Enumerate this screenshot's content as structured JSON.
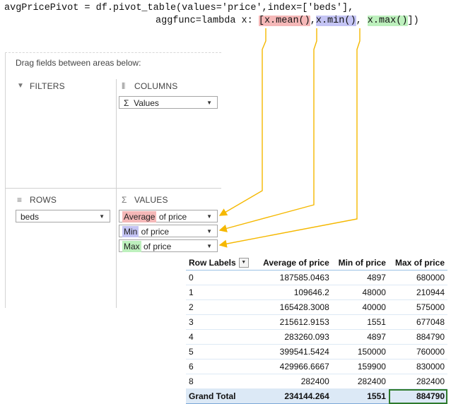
{
  "code": {
    "line1": "avgPricePivot = df.pivot_table(values='price',index=['beds'],",
    "line2_prefix": "aggfunc=lambda x: ",
    "bracket_open": "[",
    "mean_expr": "x.mean()",
    "sep1": ",",
    "min_expr": "x.min()",
    "sep2": ", ",
    "max_expr": "x.max()",
    "line2_suffix": "])"
  },
  "field_list": {
    "caption": "Drag fields between areas below:",
    "filters": {
      "title": "FILTERS",
      "icon": "filter-icon",
      "glyph": "▼"
    },
    "columns": {
      "title": "COLUMNS",
      "icon": "columns-icon",
      "glyph": "⦀",
      "field": {
        "sigma": "Σ",
        "label": "Values"
      }
    },
    "rows": {
      "title": "ROWS",
      "icon": "rows-icon",
      "glyph": "≡",
      "field": {
        "label": "beds"
      }
    },
    "values": {
      "title": "VALUES",
      "icon": "sigma-icon",
      "glyph": "Σ",
      "fields": [
        {
          "agg": "Average",
          "rest": " of price",
          "color": "#f5b8b8"
        },
        {
          "agg": "Min",
          "rest": " of price",
          "color": "#c4c4f4"
        },
        {
          "agg": "Max",
          "rest": " of price",
          "color": "#bdf0bd"
        }
      ]
    },
    "dropdown_glyph": "▼"
  },
  "pivot_table": {
    "headers": [
      "Row Labels",
      "Average of price",
      "Min of price",
      "Max of price"
    ],
    "rows": [
      [
        "0",
        "187585.0463",
        "4897",
        "680000"
      ],
      [
        "1",
        "109646.2",
        "48000",
        "210944"
      ],
      [
        "2",
        "165428.3008",
        "40000",
        "575000"
      ],
      [
        "3",
        "215612.9153",
        "1551",
        "677048"
      ],
      [
        "4",
        "283260.093",
        "4897",
        "884790"
      ],
      [
        "5",
        "399541.5424",
        "150000",
        "760000"
      ],
      [
        "6",
        "429966.6667",
        "159900",
        "830000"
      ],
      [
        "8",
        "282400",
        "282400",
        "282400"
      ]
    ],
    "grand_total": [
      "Grand Total",
      "234144.264",
      "1551",
      "884790"
    ]
  },
  "colors": {
    "arrow": "#f5b800",
    "mean": "#f5b8b8",
    "min": "#c4c4f4",
    "max": "#bdf0bd"
  }
}
